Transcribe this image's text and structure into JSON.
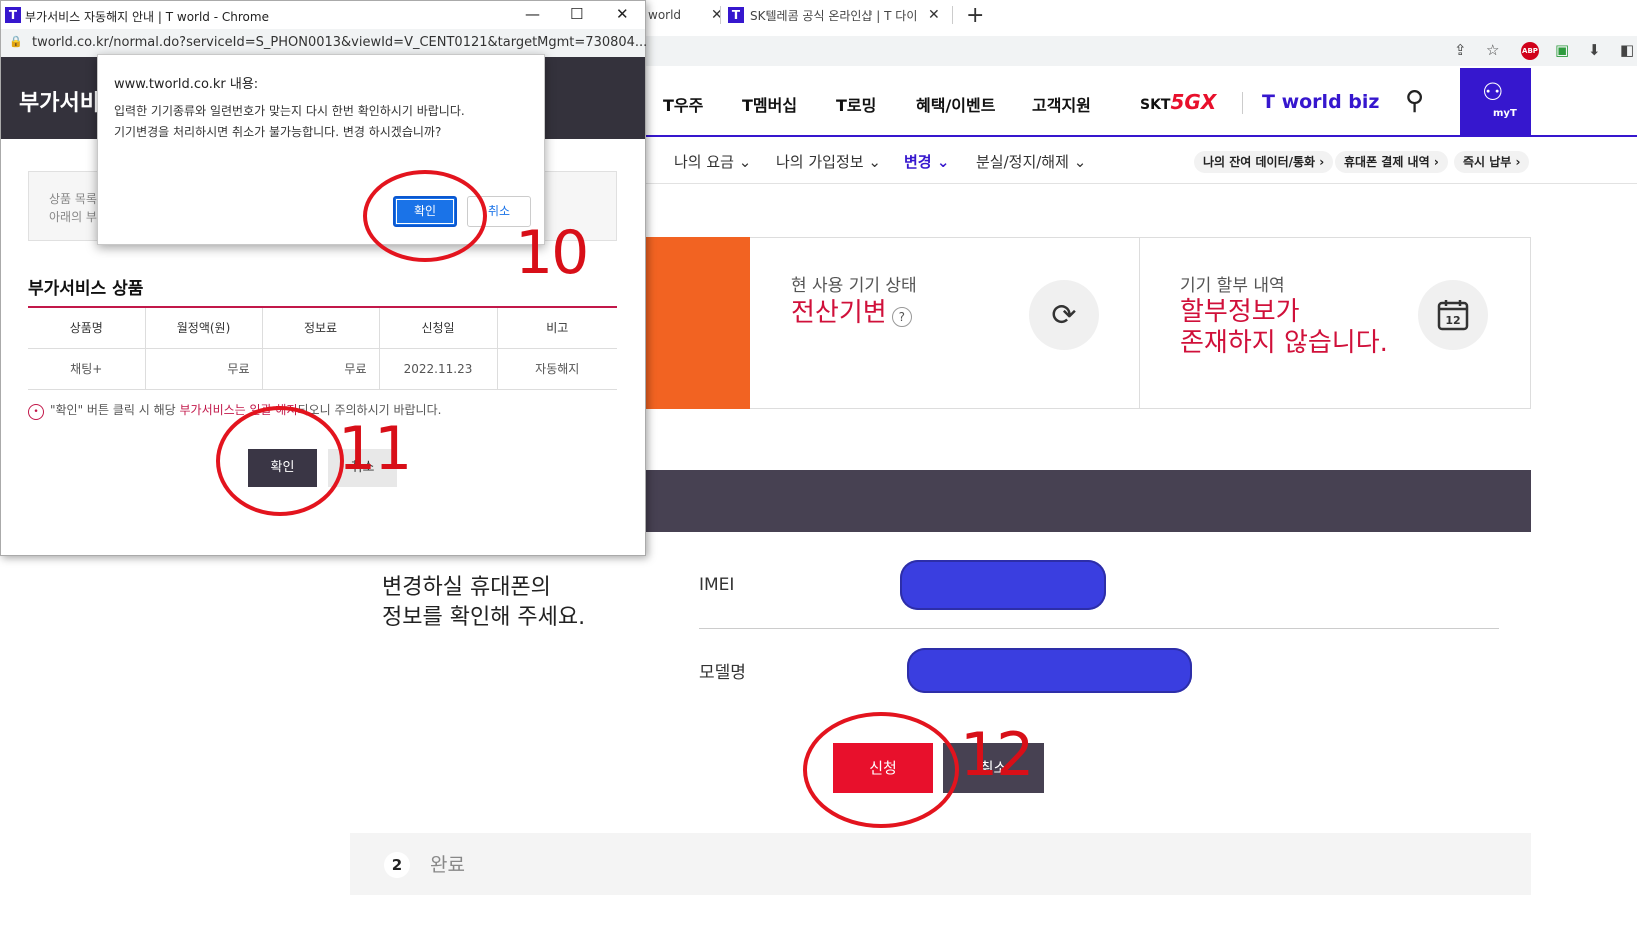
{
  "browser": {
    "tabs": [
      {
        "title": "world"
      },
      {
        "title": "SK텔레콤 공식 온라인샵 | T 다이"
      }
    ],
    "new_tab": "+",
    "toolbar_icons": [
      "share-icon",
      "star-icon",
      "adblock-icon",
      "extension-icon",
      "puzzle-icon",
      "sidebar-icon"
    ],
    "adblock_label": "ABP"
  },
  "site": {
    "main_nav": [
      "T우주",
      "T멤버십",
      "T로밍",
      "혜택/이벤트",
      "고객지원"
    ],
    "brand_skt": "SKT",
    "brand_5gx": "5GX",
    "brand_biz": "T world biz",
    "myt_label": "myT",
    "sub_nav": [
      {
        "label": "나의 요금",
        "active": false
      },
      {
        "label": "나의 가입정보",
        "active": false
      },
      {
        "label": "변경",
        "active": true
      },
      {
        "label": "분실/정지/해제",
        "active": false
      }
    ],
    "quick_links": [
      "나의 잔여 데이터/통화",
      "휴대폰 결제 내역",
      "즉시 납부"
    ],
    "cards": [
      {
        "label": "현 사용 기기 상태",
        "value": "전산기변",
        "help": "?",
        "icon": "refresh-icon"
      },
      {
        "label": "기기 할부 내역",
        "value": "할부정보가\n존재하지 않습니다.",
        "icon": "calendar-icon",
        "icon_text": "12"
      }
    ],
    "change_guide": "변경하실 휴대폰의\n정보를 확인해 주세요.",
    "fields": [
      {
        "label": "IMEI"
      },
      {
        "label": "모델명"
      }
    ],
    "apply_label": "신청",
    "cancel_label": "취소",
    "step": {
      "number": "2",
      "label": "완료"
    }
  },
  "popup": {
    "window_title": "부가서비스 자동해지 안내 | T world - Chrome",
    "url": "tworld.co.kr/normal.do?serviceId=S_PHON0013&viewId=V_CENT0121&targetMgmt=730804...",
    "heading": "부가서비스 자동해지 안내",
    "notice_line1": "상품 목록",
    "notice_line2": "아래의 부",
    "section_title": "부가서비스 상품",
    "table": {
      "headers": [
        "상품명",
        "월정액(원)",
        "정보료",
        "신청일",
        "비고"
      ],
      "rows": [
        [
          "채팅+",
          "무료",
          "무료",
          "2022.11.23",
          "자동해지"
        ]
      ]
    },
    "warning_before": "\"확인\" 버튼 클릭 시 해당 ",
    "warning_highlight": "부가서비스는 일괄 해지",
    "warning_after": "되오니 주의하시기 바랍니다.",
    "ok_label": "확인",
    "cancel_label": "취소"
  },
  "alert": {
    "origin": "www.tworld.co.kr 내용:",
    "message": "입력한 기기종류와 일련번호가 맞는지 다시 한번 확인하시기 바랍니다.\n기기변경을 처리하시면 취소가 불가능합니다. 변경 하시겠습니까?",
    "ok_label": "확인",
    "cancel_label": "취소"
  },
  "annotations": [
    "10",
    "11",
    "12"
  ],
  "colors": {
    "brand": "#3617ce",
    "accent": "#e8102c",
    "annotation": "#e3141e"
  }
}
